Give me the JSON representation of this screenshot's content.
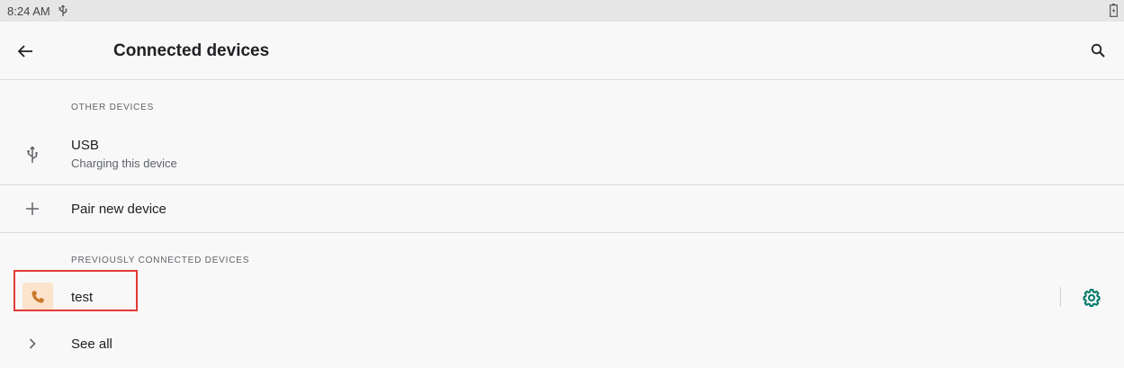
{
  "status_bar": {
    "time": "8:24 AM",
    "usb_icon": "usb-icon",
    "battery_icon": "battery-charging-icon"
  },
  "app_bar": {
    "back_icon": "arrow-back-icon",
    "title": "Connected devices",
    "search_icon": "search-icon"
  },
  "other_devices": {
    "header": "OTHER DEVICES",
    "usb": {
      "icon": "usb-icon",
      "title": "USB",
      "subtitle": "Charging this device"
    }
  },
  "pair_new": {
    "icon": "plus-icon",
    "label": "Pair new device"
  },
  "previously_connected": {
    "header": "PREVIOUSLY CONNECTED DEVICES",
    "devices": [
      {
        "icon": "phone-icon",
        "name": "test",
        "settings_icon": "gear-icon"
      }
    ]
  },
  "see_all": {
    "icon": "chevron-right-icon",
    "label": "See all"
  },
  "colors": {
    "accent": "#00796b",
    "phone_icon": "#c9772a",
    "phone_icon_bg": "#fbe3cc",
    "highlight": "#e53935"
  }
}
